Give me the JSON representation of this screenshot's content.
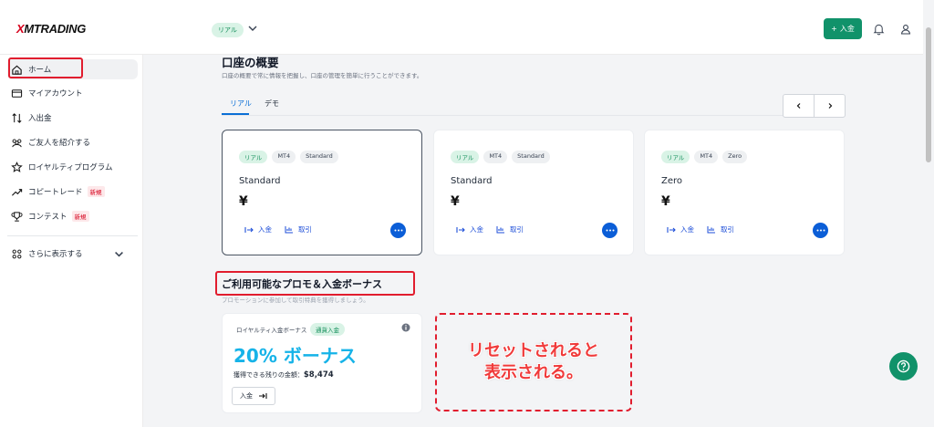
{
  "header": {
    "logo_prefix": "X",
    "logo_text": "MTRADING",
    "account_type": "リアル",
    "deposit_label": "入金"
  },
  "sidebar": {
    "items": [
      {
        "label": "ホーム"
      },
      {
        "label": "マイアカウント"
      },
      {
        "label": "入出金"
      },
      {
        "label": "ご友人を紹介する"
      },
      {
        "label": "ロイヤルティプログラム"
      },
      {
        "label": "コピートレード",
        "badge": "新規"
      },
      {
        "label": "コンテスト",
        "badge": "新規"
      }
    ],
    "more_label": "さらに表示する"
  },
  "overview": {
    "title": "口座の概要",
    "subtitle": "口座の概要で常に情報を把握し、口座の管理を簡単に行うことができます。",
    "tabs": [
      "リアル",
      "デモ"
    ]
  },
  "accounts": [
    {
      "tags": [
        "リアル",
        "MT4",
        "Standard"
      ],
      "name": "Standard",
      "balance": "¥",
      "deposit": "入金",
      "trade": "取引"
    },
    {
      "tags": [
        "リアル",
        "MT4",
        "Standard"
      ],
      "name": "Standard",
      "balance": "¥",
      "deposit": "入金",
      "trade": "取引"
    },
    {
      "tags": [
        "リアル",
        "MT4",
        "Zero"
      ],
      "name": "Zero",
      "balance": "¥",
      "deposit": "入金",
      "trade": "取引"
    }
  ],
  "promos": {
    "title": "ご利用可能なプロモ＆入金ボーナス",
    "subtitle": "プロモーションに参加して取引特典を獲得しましょう。",
    "card": {
      "label": "ロイヤルティ入金ボーナス",
      "tag": "通貨入金",
      "headline": "20% ボーナス",
      "remaining_label": "獲得できる残りの金額：",
      "remaining_value": "$8,474",
      "deposit": "入金"
    }
  },
  "annotation": {
    "note": "リセットされると\n表示される。"
  },
  "colors": {
    "brand_green": "#11926a",
    "link_blue": "#0b6fd6",
    "highlight_red": "#e11d2e",
    "promo_cyan": "#16b3e8"
  }
}
